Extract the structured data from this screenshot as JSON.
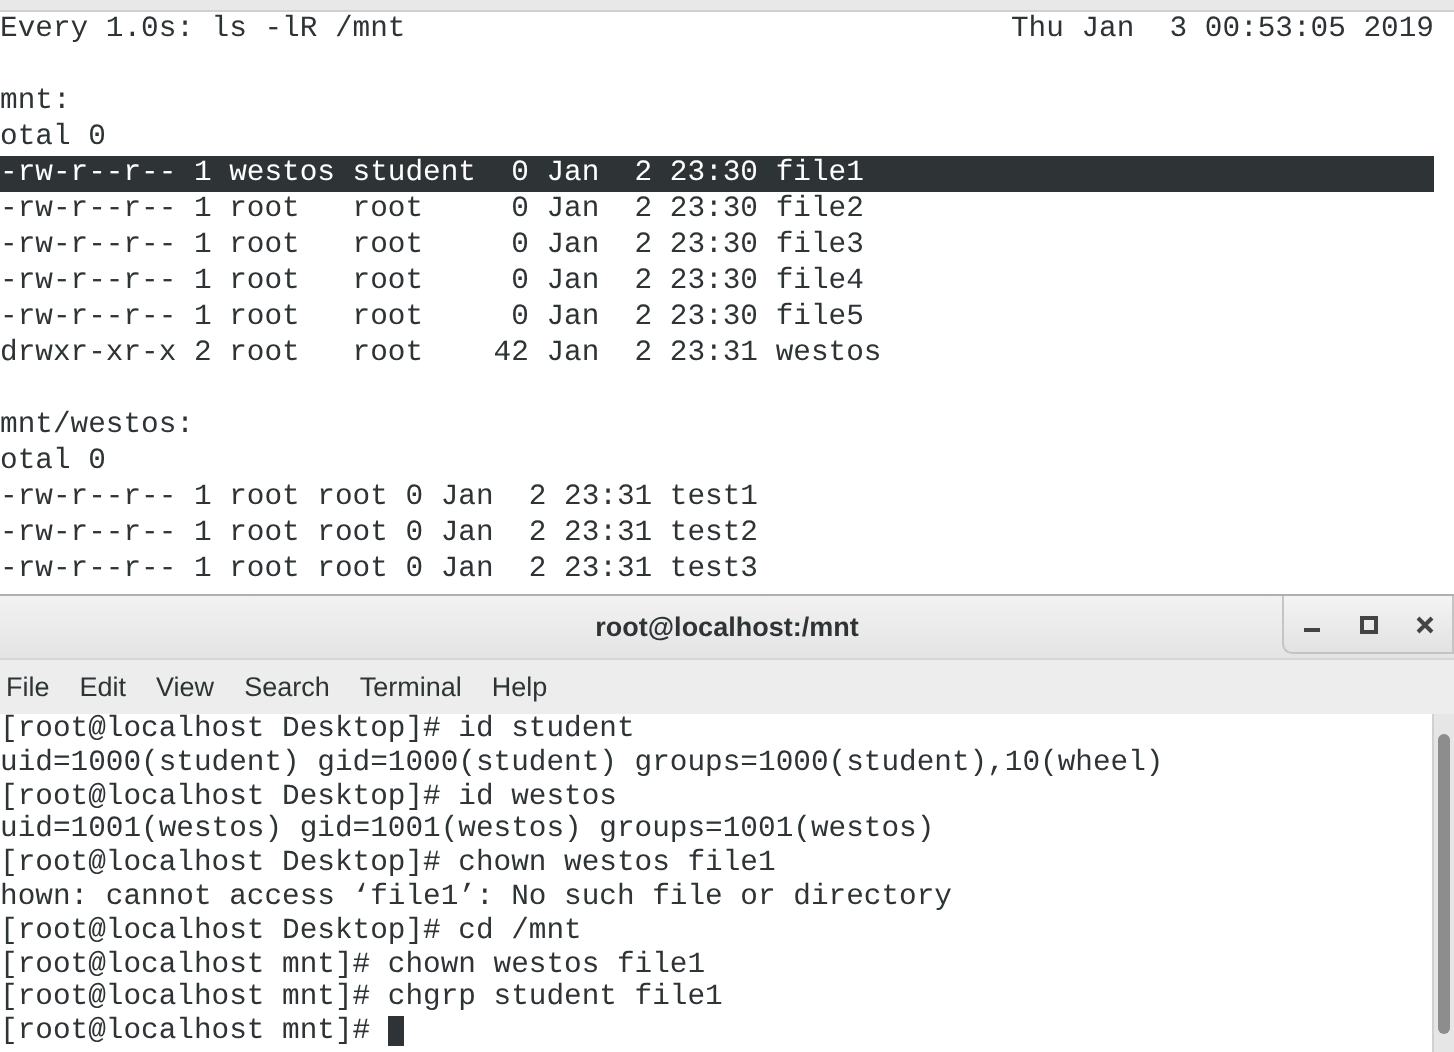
{
  "watch_terminal": {
    "command": "Every 1.0s: ls -lR /mnt",
    "clock": "Thu Jan  3 00:53:05 2019",
    "lines": [
      {
        "text": "mnt:",
        "selected": false,
        "gap_before": true
      },
      {
        "text": "otal 0",
        "selected": false
      },
      {
        "text": "-rw-r--r-- 1 westos student  0 Jan  2 23:30 file1",
        "selected": true
      },
      {
        "text": "-rw-r--r-- 1 root   root     0 Jan  2 23:30 file2",
        "selected": false
      },
      {
        "text": "-rw-r--r-- 1 root   root     0 Jan  2 23:30 file3",
        "selected": false
      },
      {
        "text": "-rw-r--r-- 1 root   root     0 Jan  2 23:30 file4",
        "selected": false
      },
      {
        "text": "-rw-r--r-- 1 root   root     0 Jan  2 23:30 file5",
        "selected": false
      },
      {
        "text": "drwxr-xr-x 2 root   root    42 Jan  2 23:31 westos",
        "selected": false
      },
      {
        "text": "mnt/westos:",
        "selected": false,
        "gap_before": true
      },
      {
        "text": "otal 0",
        "selected": false
      },
      {
        "text": "-rw-r--r-- 1 root root 0 Jan  2 23:31 test1",
        "selected": false
      },
      {
        "text": "-rw-r--r-- 1 root root 0 Jan  2 23:31 test2",
        "selected": false
      },
      {
        "text": "-rw-r--r-- 1 root root 0 Jan  2 23:31 test3",
        "selected": false
      }
    ]
  },
  "window": {
    "title": "root@localhost:/mnt",
    "menu": [
      "File",
      "Edit",
      "View",
      "Search",
      "Terminal",
      "Help"
    ],
    "lines": [
      "[root@localhost Desktop]# id student",
      "uid=1000(student) gid=1000(student) groups=1000(student),10(wheel)",
      "[root@localhost Desktop]# id westos",
      "uid=1001(westos) gid=1001(westos) groups=1001(westos)",
      "[root@localhost Desktop]# chown westos file1",
      "hown: cannot access ‘file1’: No such file or directory",
      "[root@localhost Desktop]# cd /mnt",
      "[root@localhost mnt]# chown westos file1",
      "[root@localhost mnt]# chgrp student file1",
      "[root@localhost mnt]# "
    ]
  }
}
